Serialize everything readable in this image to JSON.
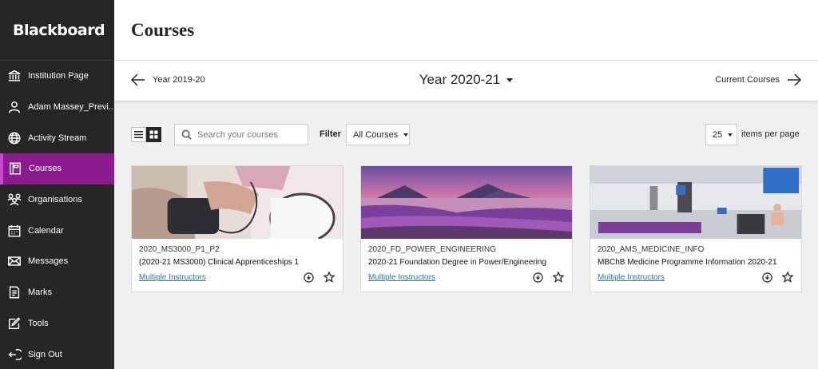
{
  "brand": {
    "name": "Blackboard"
  },
  "sidebar": {
    "items": [
      {
        "label": "Institution Page",
        "icon": "institution-icon"
      },
      {
        "label": "Adam Massey_Previ...",
        "icon": "user-icon"
      },
      {
        "label": "Activity Stream",
        "icon": "globe-icon"
      },
      {
        "label": "Courses",
        "icon": "courses-icon",
        "active": true
      },
      {
        "label": "Organisations",
        "icon": "organisations-icon"
      },
      {
        "label": "Calendar",
        "icon": "calendar-icon"
      },
      {
        "label": "Messages",
        "icon": "envelope-icon"
      },
      {
        "label": "Marks",
        "icon": "marks-icon"
      },
      {
        "label": "Tools",
        "icon": "tools-icon"
      },
      {
        "label": "Sign Out",
        "icon": "sign-out-icon"
      }
    ]
  },
  "header": {
    "title": "Courses"
  },
  "term_nav": {
    "previous_label": "Year 2019-20",
    "current_label": "Year 2020-21",
    "next_label": "Current Courses"
  },
  "toolbar": {
    "search_placeholder": "Search your courses",
    "filter_label": "Filter",
    "filter_value": "All Courses",
    "per_page_value": "25",
    "per_page_label": "items per page"
  },
  "courses": [
    {
      "id": "2020_MS3000_P1_P2",
      "title": "(2020-21 MS3000) Clinical Apprenticeships 1",
      "instructors": "Multiple Instructors"
    },
    {
      "id": "2020_FD_POWER_ENGINEERING",
      "title": "2020-21 Foundation Degree in Power/Engineering",
      "instructors": "Multiple Instructors"
    },
    {
      "id": "2020_AMS_MEDICINE_INFO",
      "title": "MBChB Medicine Programme Information 2020-21",
      "instructors": "Multiple Instructors"
    }
  ],
  "colors": {
    "sidebar_bg": "#262626",
    "active_nav": "#8c1b8f",
    "link": "#2a73b8"
  }
}
